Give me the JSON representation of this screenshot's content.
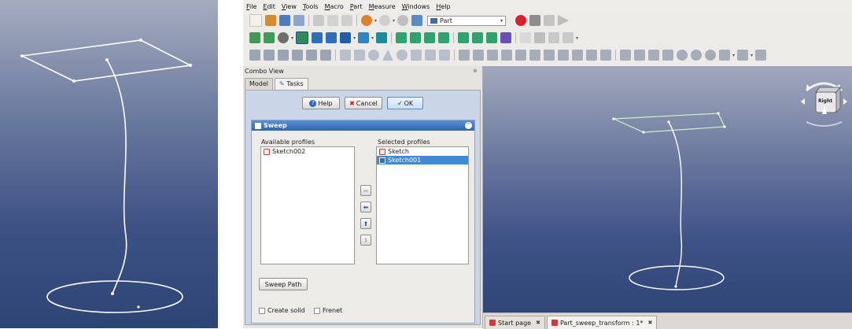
{
  "menu": [
    "File",
    "Edit",
    "View",
    "Tools",
    "Macro",
    "Part",
    "Measure",
    "Windows",
    "Help"
  ],
  "toolbar": {
    "workbench": "Part"
  },
  "combo_view": {
    "title": "Combo View",
    "tabs": [
      "Model",
      "Tasks"
    ],
    "active_tab": "Tasks"
  },
  "task_buttons": {
    "help": "Help",
    "cancel": "Cancel",
    "ok": "OK"
  },
  "sweep": {
    "title": "Sweep",
    "available_label": "Available profiles",
    "selected_label": "Selected profiles",
    "available_items": [
      "Sketch002"
    ],
    "selected_items": [
      "Sketch",
      "Sketch001"
    ],
    "selected_highlight": "Sketch001",
    "sweep_path_label": "Sweep Path",
    "create_solid_label": "Create solid",
    "frenet_label": "Frenet",
    "create_solid_checked": false,
    "frenet_checked": false
  },
  "nav_cube": {
    "face_label": "Right"
  },
  "doc_tabs": [
    {
      "label": "Start page",
      "active": false
    },
    {
      "label": "Part_sweep_transform : 1*",
      "active": true
    }
  ],
  "icons": {
    "help": "help-icon",
    "cancel": "cancel-icon",
    "ok": "ok-checkmark-icon",
    "sweep": "sweep-icon",
    "sketch": "sketch-icon",
    "arrows": [
      "arrow-right-icon",
      "arrow-left-icon",
      "arrow-up-icon",
      "arrow-down-icon"
    ]
  },
  "colors": {
    "viewport_top": "#a2a9bd",
    "viewport_bottom": "#2f4676",
    "selection": "#3d8ad6",
    "panel_header": "#2f64b0"
  }
}
